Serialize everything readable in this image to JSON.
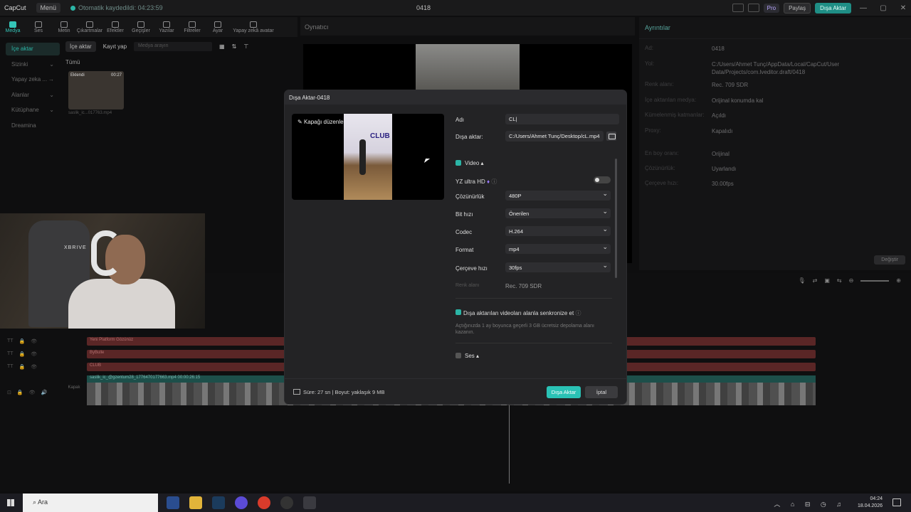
{
  "app": {
    "logo": "CapCut",
    "menu": "Menü",
    "autosave": "Otomatik kaydedildi: 04:23:59",
    "project_title": "0418",
    "pro": "Pro",
    "share": "Paylaş",
    "export": "Dışa Aktar"
  },
  "toolbar": [
    {
      "label": "Medya",
      "active": true
    },
    {
      "label": "Ses"
    },
    {
      "label": "Metin"
    },
    {
      "label": "Çıkartmalar"
    },
    {
      "label": "Efektler"
    },
    {
      "label": "Geçişler"
    },
    {
      "label": "Yazılar"
    },
    {
      "label": "Filtreler"
    },
    {
      "label": "Ayar"
    },
    {
      "label": "Yapay zekâ avatar"
    }
  ],
  "leftnav": [
    {
      "label": "İçe aktar",
      "active": true
    },
    {
      "label": "Sizinki"
    },
    {
      "label": "Yapay zeka ..."
    },
    {
      "label": "Alanlar"
    },
    {
      "label": "Kütüphane"
    },
    {
      "label": "Dreamina"
    }
  ],
  "media": {
    "import_btn": "İçe aktar",
    "record_btn": "Kayıt yap",
    "search_placeholder": "Medya arayın",
    "filter_label": "Tümü",
    "thumb_tag": "Eklendi",
    "thumb_duration": "00:27",
    "thumb_name": "saslik_ic...017763.mp4"
  },
  "player": {
    "title": "Oynatıcı"
  },
  "details": {
    "title": "Ayrıntılar",
    "rows": [
      {
        "label": "Ad:",
        "value": "0418"
      },
      {
        "label": "Yol:",
        "value": "C:/Users/Ahmet Tunç/AppData/Local/CapCut/User Data/Projects/com.lveditor.draft/0418"
      },
      {
        "label": "Renk alanı:",
        "value": "Rec. 709 SDR"
      },
      {
        "label": "İçe aktarılan medya:",
        "value": "Orijinal konumda kal"
      },
      {
        "label": "Kümelenmiş katmanlar:",
        "value": "Açıldı"
      },
      {
        "label": "Proxy:",
        "value": "Kapalıdı"
      },
      {
        "label": "En boy oranı:",
        "value": "Orijinal"
      },
      {
        "label": "Çözünürlük:",
        "value": "Uyarlandı"
      },
      {
        "label": "Çerçeve hızı:",
        "value": "30.00fps"
      }
    ],
    "change_btn": "Değiştir"
  },
  "timeline": {
    "tracks": [
      {
        "label": "Yeni Platform Gözünüz"
      },
      {
        "label": "ByBulle"
      },
      {
        "label": "CLUB"
      }
    ],
    "video_label": "saslik_ic_@gzentum28_1776470177663.mp4  00:00:26:15",
    "cover_label": "Kapak"
  },
  "modal": {
    "title": "Dışa Aktar-0418",
    "cover_edit": "Kapağı düzenle",
    "cover_club": "CLUB",
    "name_label": "Adı",
    "name_value": "CL|",
    "path_label": "Dışa aktar:",
    "path_value": "C:/Users/Ahmet Tunç/Desktop/cL.mp4",
    "video_section": "Video",
    "uhd_label": "YZ ultra HD",
    "resolution_label": "Çözünürlük",
    "resolution_value": "480P",
    "bitrate_label": "Bit hızı",
    "bitrate_value": "Önerilen",
    "codec_label": "Codec",
    "codec_value": "H.264",
    "format_label": "Format",
    "format_value": "mp4",
    "framerate_label": "Çerçeve hızı",
    "framerate_value": "30fps",
    "colorspace_label": "Renk alanı",
    "colorspace_value": "Rec. 709 SDR",
    "sync_label": "Dışa aktarılan videoları alanla senkronize et",
    "sync_note": "Açtığınızda 1 ay boyunca geçerli 3 GB ücretsiz depolama alanı kazanın.",
    "audio_section": "Ses",
    "footer_info": "Süre: 27 sn | Boyut: yaklaşık 9 MB",
    "export_btn": "Dışa Aktar",
    "cancel_btn": "İptal"
  },
  "webcam": {
    "chair_logo": "XBRIVE"
  },
  "taskbar": {
    "search_text": "Ara",
    "time": "04:24",
    "date": "18.04.2026"
  },
  "colors": {
    "accent": "#2bb5a6",
    "modal_bg": "#232325",
    "track_red": "#5a2626"
  }
}
